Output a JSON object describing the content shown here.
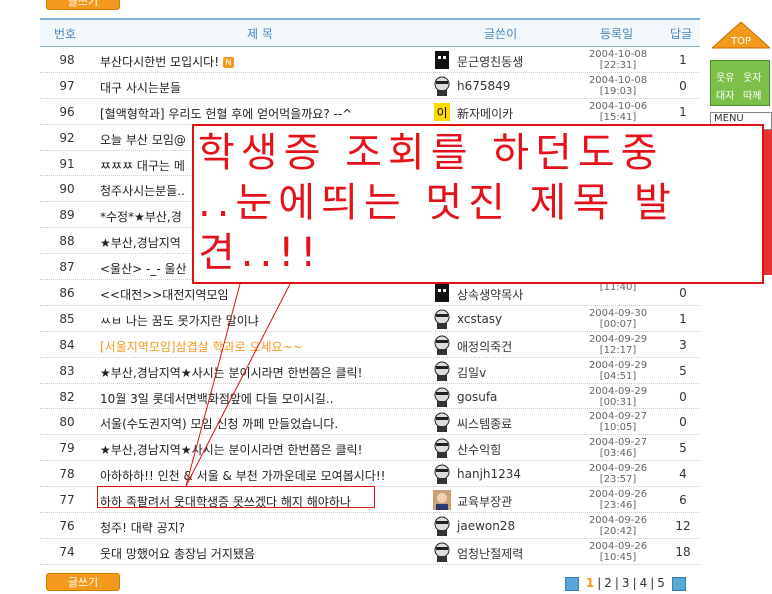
{
  "write_button": "글쓰기",
  "header": {
    "num": "번호",
    "title": "제 목",
    "writer": "글쓴이",
    "date": "등록일",
    "reply": "답글"
  },
  "rows": [
    {
      "num": "98",
      "title": "부산다시한번 모입시다!",
      "new": "N",
      "writer": "문근영친동생",
      "date1": "2004-10-08",
      "date2": "[22:31]",
      "rep": "1",
      "avatar": "black-face"
    },
    {
      "num": "97",
      "title": "대구 사시는분들",
      "writer": "h675849",
      "date1": "2004-10-08",
      "date2": "[19:03]",
      "rep": "0",
      "avatar": "bald-man"
    },
    {
      "num": "96",
      "title": "[혈액형학과] 우리도 헌혈 후에 얻어먹을까요? --^",
      "writer": "新자메이카",
      "date1": "2004-10-06",
      "date2": "[15:41]",
      "rep": "1",
      "avatar": "yellow-badge"
    },
    {
      "num": "92",
      "title": "오늘 부산 모임@",
      "writer": "",
      "date1": "",
      "date2": "",
      "rep": ""
    },
    {
      "num": "91",
      "title": "ㅉㅉㅉ 대구는 메",
      "writer": "",
      "date1": "",
      "date2": "",
      "rep": ""
    },
    {
      "num": "90",
      "title": "청주사시는분들..",
      "writer": "",
      "date1": "",
      "date2": "",
      "rep": ""
    },
    {
      "num": "89",
      "title": "*수정*★부산,경",
      "writer": "",
      "date1": "",
      "date2": "",
      "rep": ""
    },
    {
      "num": "88",
      "title": "★부산,경남지역",
      "writer": "",
      "date1": "",
      "date2": "",
      "rep": ""
    },
    {
      "num": "87",
      "title": "<울산> -_- 울산",
      "writer": "",
      "date1": "",
      "date2": "",
      "rep": ""
    },
    {
      "num": "86",
      "title": "<<대전>>대전지역모임",
      "writer": "상속생약목사",
      "date1": "",
      "date2": "[11:40]",
      "rep": "0",
      "avatar": "black-face"
    },
    {
      "num": "85",
      "title": "ㅆㅂ 나는 꿈도 못가지란 말이냐",
      "writer": "xcstasy",
      "date1": "2004-09-30",
      "date2": "[00:07]",
      "rep": "1",
      "avatar": "bald-man"
    },
    {
      "num": "84",
      "title": "[서울지역모임]삼겹살 학과로 오세요~~",
      "orange": true,
      "writer": "애정의죽건",
      "date1": "2004-09-29",
      "date2": "[12:17]",
      "rep": "3",
      "avatar": "bald-man"
    },
    {
      "num": "83",
      "title": "★부산,경남지역★사시는 분이시라면 한번쯤은 클릭!",
      "writer": "김일v",
      "date1": "2004-09-29",
      "date2": "[04:51]",
      "rep": "5",
      "avatar": "bald-man"
    },
    {
      "num": "82",
      "title": "10월 3일 롯데서면백화점앞에 다들 모이시길..",
      "writer": "gosufa",
      "date1": "2004-09-29",
      "date2": "[00:31]",
      "rep": "0",
      "avatar": "bald-man"
    },
    {
      "num": "80",
      "title": "서울(수도권지역) 모임 신청 까페 만들었습니다.",
      "writer": "씨스템종료",
      "date1": "2004-09-27",
      "date2": "[10:05]",
      "rep": "0",
      "avatar": "bald-man"
    },
    {
      "num": "79",
      "title": "★부산,경남지역★사시는 분이시라면 한번쯤은 클릭!",
      "writer": "산수익힘",
      "date1": "2004-09-27",
      "date2": "[03:46]",
      "rep": "5",
      "avatar": "bald-man"
    },
    {
      "num": "78",
      "title": "아하하하!! 인천 & 서울 & 부천 가까운데로 모여봅시다!!",
      "writer": "hanjh1234",
      "date1": "2004-09-26",
      "date2": "[23:57]",
      "rep": "4",
      "avatar": "bald-man"
    },
    {
      "num": "77",
      "title": "하하 족팔려서 웃대학생증 못쓰겠다 해지 해야하나",
      "writer": "교육부장관",
      "date1": "2004-09-26",
      "date2": "[23:46]",
      "rep": "6",
      "avatar": "photo"
    },
    {
      "num": "76",
      "title": "청주! 대략 공지?",
      "writer": "jaewon28",
      "date1": "2004-09-26",
      "date2": "[20:42]",
      "rep": "12",
      "avatar": "bald-man"
    },
    {
      "num": "74",
      "title": "웃대 망했어요 총장님 거지됐음",
      "writer": "엄청난절제력",
      "date1": "2004-09-26",
      "date2": "[10:45]",
      "rep": "18",
      "avatar": "bald-man"
    }
  ],
  "pager": {
    "pages": [
      "1",
      "2",
      "3",
      "4",
      "5"
    ],
    "current": "1"
  },
  "side": {
    "top_label": "TOP",
    "box": [
      "웃유",
      "웃자",
      "대자",
      "따께"
    ],
    "menu": "MENU"
  },
  "overlay": {
    "line1": "학생증 조회를 하던도중",
    "line2": "..눈에띄는 멋진 제목 발",
    "line3": "견..!!"
  },
  "colors": {
    "accent": "#f39a1e",
    "header_text": "#4a87c0",
    "annotation": "#e5121c"
  }
}
